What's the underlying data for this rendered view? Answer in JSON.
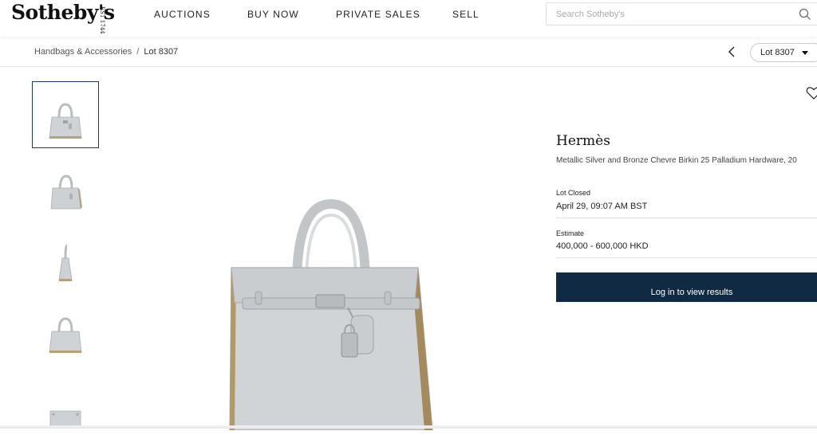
{
  "header": {
    "logo": "Sotheby's",
    "logo_est": "EST 1744",
    "nav": [
      {
        "label": "AUCTIONS"
      },
      {
        "label": "BUY NOW"
      },
      {
        "label": "PRIVATE SALES"
      },
      {
        "label": "SELL"
      }
    ],
    "search_placeholder": "Search Sotheby's"
  },
  "breadcrumb": {
    "category": "Handbags & Accessories",
    "separator": "/",
    "current": "Lot 8307"
  },
  "lot_selector": {
    "label": "Lot 8307"
  },
  "thumbnails": [
    {
      "view": "front-with-handles",
      "selected": true
    },
    {
      "view": "three-quarter",
      "selected": false
    },
    {
      "view": "side",
      "selected": false
    },
    {
      "view": "back",
      "selected": false
    },
    {
      "view": "bottom",
      "selected": false
    }
  ],
  "lot": {
    "brand": "Hermès",
    "title": "Metallic Silver and Bronze Chevre Birkin 25 Palladium Hardware, 20",
    "status_label": "Lot Closed",
    "closed_date": "April 29, 09:07 AM BST",
    "estimate_label": "Estimate",
    "estimate": "400,000 - 600,000 HKD",
    "cta": "Log in to view results"
  },
  "colors": {
    "accent": "#102a43",
    "selected_border": "#1f3a5f",
    "bag_silver": "#c9cdcf",
    "bag_trim": "#a58a5c"
  }
}
